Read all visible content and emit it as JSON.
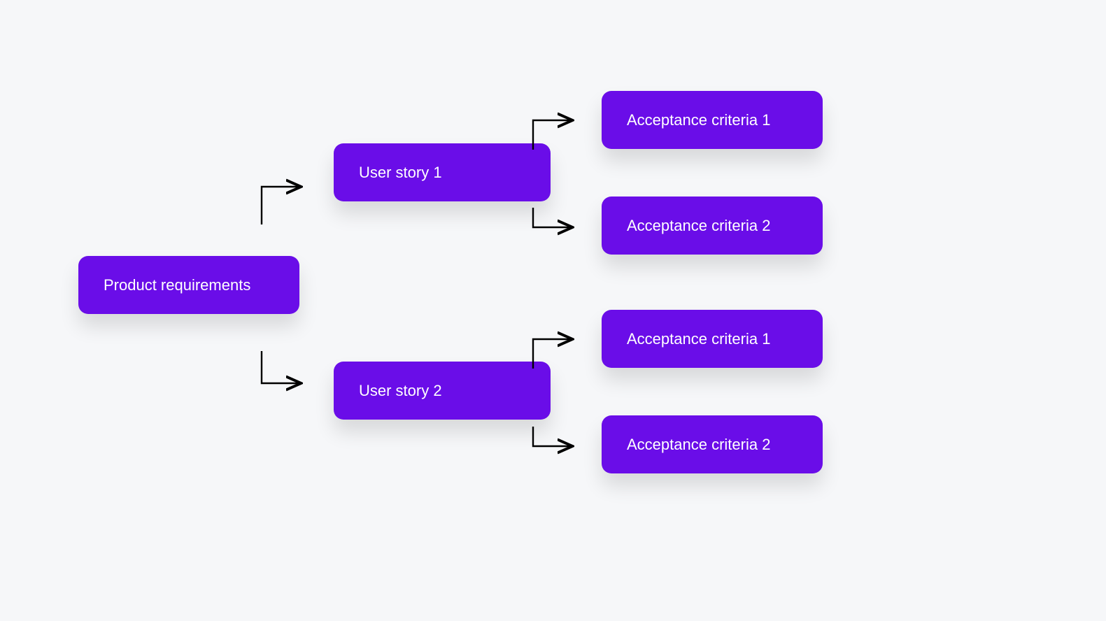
{
  "root": {
    "label": "Product requirements"
  },
  "stories": [
    {
      "label": "User story 1",
      "criteria": [
        {
          "label": "Acceptance criteria 1"
        },
        {
          "label": "Acceptance criteria 2"
        }
      ]
    },
    {
      "label": "User story 2",
      "criteria": [
        {
          "label": "Acceptance criteria 1"
        },
        {
          "label": "Acceptance criteria 2"
        }
      ]
    }
  ]
}
